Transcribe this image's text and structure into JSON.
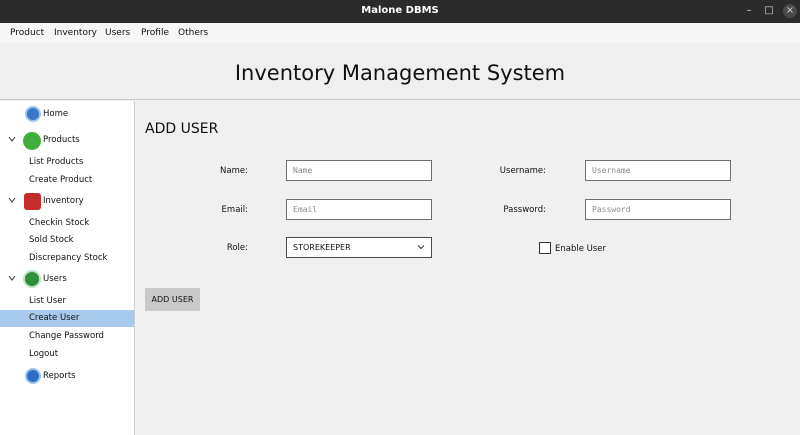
{
  "window": {
    "title": "Malone DBMS",
    "min_glyph": "–",
    "max_glyph": "□",
    "close_glyph": "×"
  },
  "menu": [
    "Product",
    "Inventory",
    "Users",
    "Profile",
    "Others"
  ],
  "header": {
    "title": "Inventory Management System"
  },
  "sidebar": {
    "home": "Home",
    "products": {
      "label": "Products",
      "items": [
        "List Products",
        "Create Product"
      ]
    },
    "inventory": {
      "label": "Inventory",
      "items": [
        "Checkin Stock",
        "Sold Stock",
        "Discrepancy Stock"
      ]
    },
    "users": {
      "label": "Users",
      "items": [
        "List User",
        "Create User",
        "Change Password",
        "Logout"
      ]
    },
    "reports": "Reports",
    "selected": "Create User",
    "colors": {
      "selected_bg": "#a6c9ec"
    }
  },
  "form": {
    "title": "ADD USER",
    "name_label": "Name:",
    "name_placeholder": "Name",
    "username_label": "Username:",
    "username_placeholder": "Username",
    "email_label": "Email:",
    "email_placeholder": "Email",
    "password_label": "Password:",
    "password_placeholder": "Password",
    "role_label": "Role:",
    "role_value": "STOREKEEPER",
    "enable_label": "Enable User",
    "enable_checked": false,
    "submit_label": "ADD USER"
  }
}
